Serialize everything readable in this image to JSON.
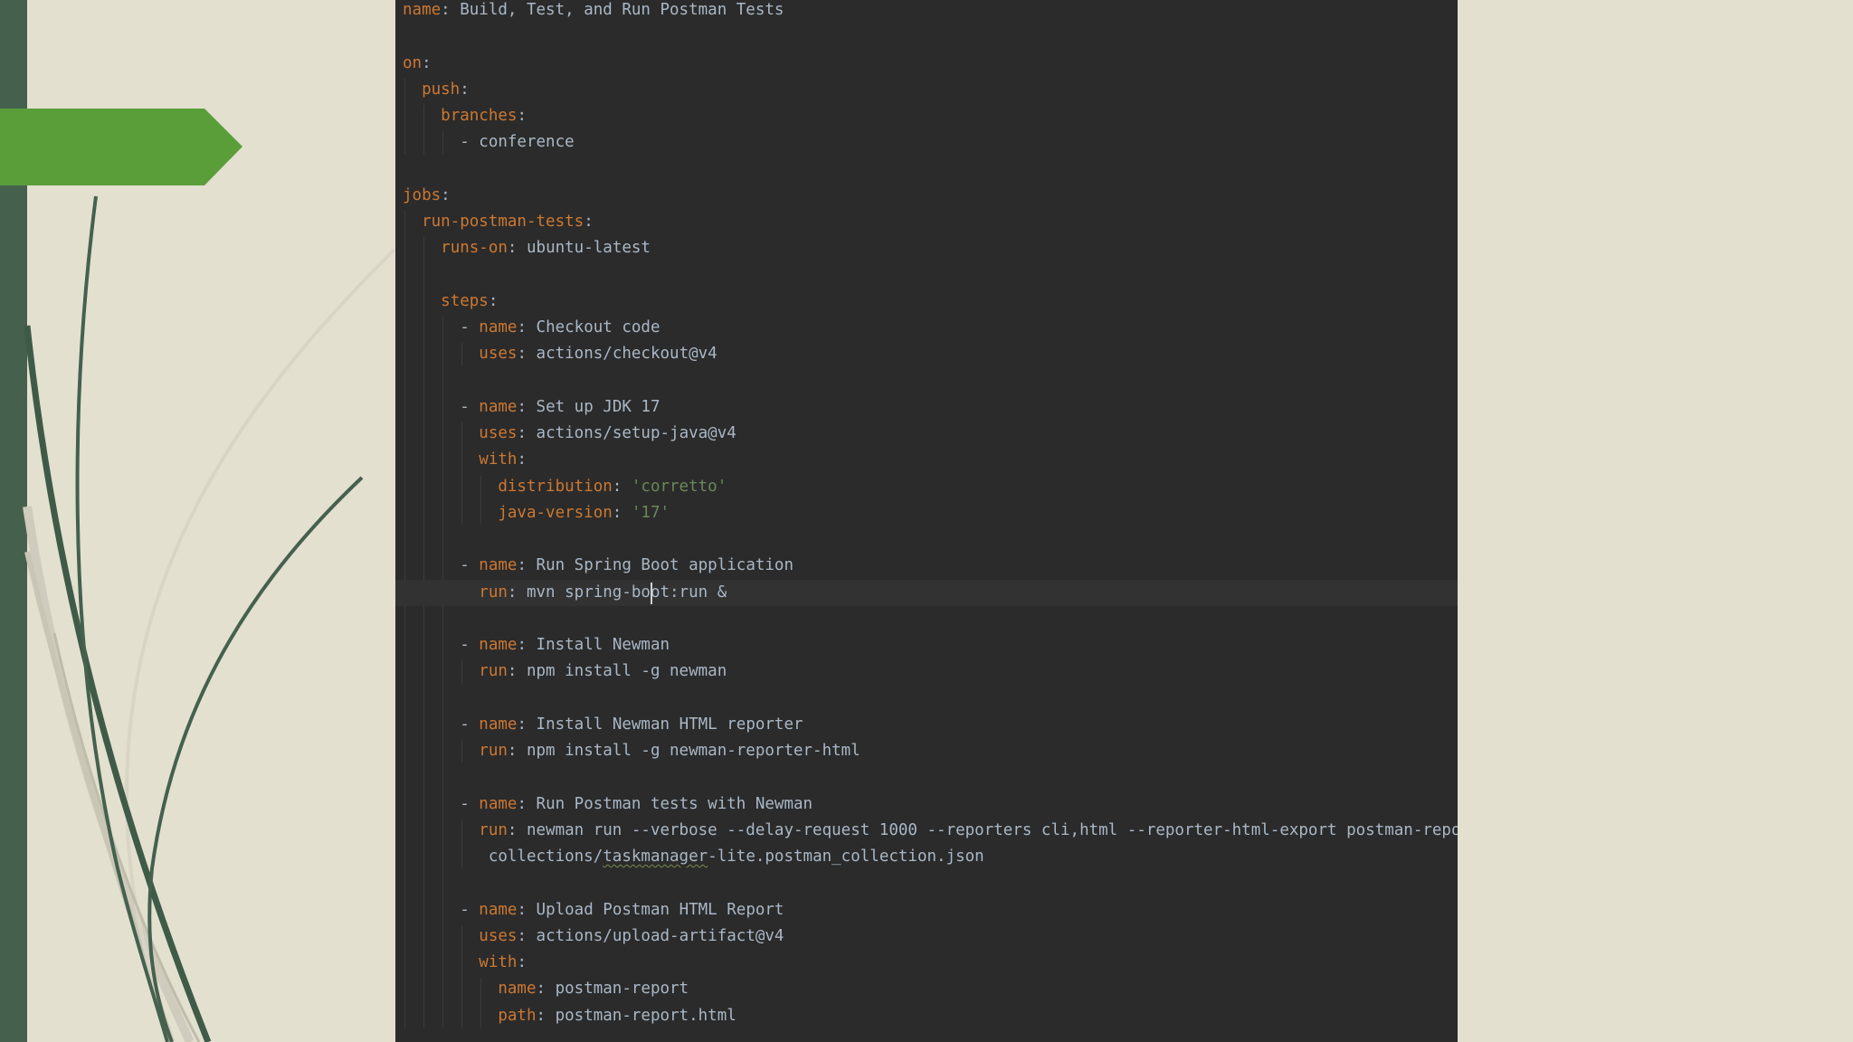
{
  "slide": {
    "accent_color": "#5a9e3a",
    "sidebar_color": "#45614e",
    "background_color": "#e3e0d0"
  },
  "editor": {
    "background": "#2b2b2b",
    "key_color": "#cc7832",
    "text_color": "#a9b7c6",
    "string_color": "#6a8759",
    "lines": [
      {
        "indent": "",
        "key": "name",
        "value": "Build, Test, and Run Postman Tests",
        "vtype": "plain"
      },
      {
        "indent": "",
        "key": "",
        "value": "",
        "vtype": "plain"
      },
      {
        "indent": "",
        "key": "on",
        "value": "",
        "vtype": "plain"
      },
      {
        "indent": "  ",
        "key": "push",
        "value": "",
        "vtype": "plain"
      },
      {
        "indent": "    ",
        "key": "branches",
        "value": "",
        "vtype": "plain"
      },
      {
        "indent": "      ",
        "key": "",
        "value": "- conference",
        "vtype": "plain"
      },
      {
        "indent": "",
        "key": "",
        "value": "",
        "vtype": "plain"
      },
      {
        "indent": "",
        "key": "jobs",
        "value": "",
        "vtype": "plain"
      },
      {
        "indent": "  ",
        "key": "run-postman-tests",
        "value": "",
        "vtype": "plain"
      },
      {
        "indent": "    ",
        "key": "runs-on",
        "value": "ubuntu-latest",
        "vtype": "plain"
      },
      {
        "indent": "",
        "key": "",
        "value": "",
        "vtype": "plain"
      },
      {
        "indent": "    ",
        "key": "steps",
        "value": "",
        "vtype": "plain"
      },
      {
        "indent": "      - ",
        "key": "name",
        "value": "Checkout code",
        "vtype": "plain"
      },
      {
        "indent": "        ",
        "key": "uses",
        "value": "actions/checkout@v4",
        "vtype": "plain"
      },
      {
        "indent": "",
        "key": "",
        "value": "",
        "vtype": "plain"
      },
      {
        "indent": "      - ",
        "key": "name",
        "value": "Set up JDK 17",
        "vtype": "plain"
      },
      {
        "indent": "        ",
        "key": "uses",
        "value": "actions/setup-java@v4",
        "vtype": "plain"
      },
      {
        "indent": "        ",
        "key": "with",
        "value": "",
        "vtype": "plain"
      },
      {
        "indent": "          ",
        "key": "distribution",
        "value": "'corretto'",
        "vtype": "string"
      },
      {
        "indent": "          ",
        "key": "java-version",
        "value": "'17'",
        "vtype": "string"
      },
      {
        "indent": "",
        "key": "",
        "value": "",
        "vtype": "plain"
      },
      {
        "indent": "      - ",
        "key": "name",
        "value": "Run Spring Boot application",
        "vtype": "plain"
      },
      {
        "indent": "        ",
        "key": "run",
        "value": "mvn spring-boot:run &",
        "vtype": "plain",
        "current": true,
        "caret_after": "mvn spring-bo"
      },
      {
        "indent": "",
        "key": "",
        "value": "",
        "vtype": "plain"
      },
      {
        "indent": "      - ",
        "key": "name",
        "value": "Install Newman",
        "vtype": "plain"
      },
      {
        "indent": "        ",
        "key": "run",
        "value": "npm install -g newman",
        "vtype": "plain"
      },
      {
        "indent": "",
        "key": "",
        "value": "",
        "vtype": "plain"
      },
      {
        "indent": "      - ",
        "key": "name",
        "value": "Install Newman HTML reporter",
        "vtype": "plain"
      },
      {
        "indent": "        ",
        "key": "run",
        "value": "npm install -g newman-reporter-html",
        "vtype": "plain"
      },
      {
        "indent": "",
        "key": "",
        "value": "",
        "vtype": "plain"
      },
      {
        "indent": "      - ",
        "key": "name",
        "value": "Run Postman tests with Newman",
        "vtype": "plain"
      },
      {
        "indent": "        ",
        "key": "run",
        "value": "newman run --verbose --delay-request 1000 --reporters cli,html --reporter-html-export postman-report.html",
        "vtype": "plain"
      },
      {
        "indent": "         ",
        "key": "",
        "value": "collections/taskmanager-lite.postman_collection.json",
        "vtype": "squiggle",
        "squiggle_word": "taskmanager"
      },
      {
        "indent": "",
        "key": "",
        "value": "",
        "vtype": "plain"
      },
      {
        "indent": "      - ",
        "key": "name",
        "value": "Upload Postman HTML Report",
        "vtype": "plain"
      },
      {
        "indent": "        ",
        "key": "uses",
        "value": "actions/upload-artifact@v4",
        "vtype": "plain"
      },
      {
        "indent": "        ",
        "key": "with",
        "value": "",
        "vtype": "plain"
      },
      {
        "indent": "          ",
        "key": "name",
        "value": "postman-report",
        "vtype": "plain"
      },
      {
        "indent": "          ",
        "key": "path",
        "value": "postman-report.html",
        "vtype": "plain"
      }
    ]
  }
}
